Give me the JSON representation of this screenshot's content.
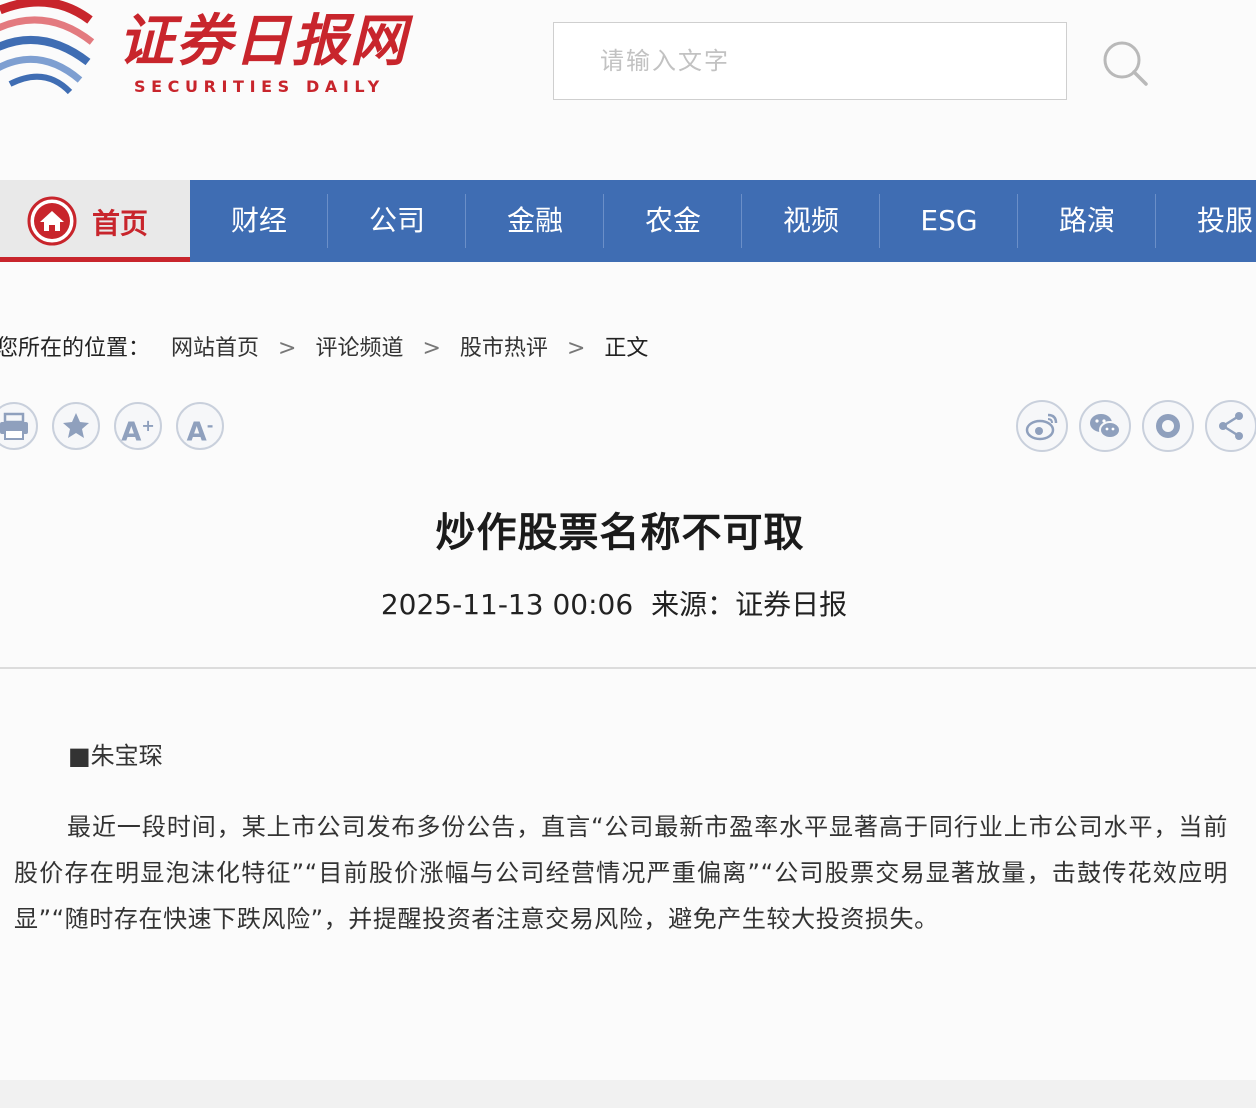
{
  "site": {
    "logo_cn": "证券日报网",
    "logo_en": "SECURITIES DAILY",
    "brand_color": "#c8252c",
    "nav_color": "#3f6db3"
  },
  "search": {
    "placeholder": "请输入文字",
    "icon": "search-icon"
  },
  "nav": {
    "home": {
      "label": "首页",
      "icon": "home-icon"
    },
    "items": [
      "财经",
      "公司",
      "金融",
      "农金",
      "视频",
      "ESG",
      "路演",
      "投服"
    ]
  },
  "breadcrumb": {
    "prefix": "您所在的位置：",
    "items": [
      "网站首页",
      "评论频道",
      "股市热评",
      "正文"
    ],
    "separator": ">"
  },
  "toolbar": {
    "left": [
      "print-icon",
      "favorite-star-icon",
      "font-increase-icon",
      "font-decrease-icon"
    ],
    "right": [
      "weibo-icon",
      "wechat-icon",
      "qzone-icon",
      "share-icon"
    ],
    "font_increase_label": "A",
    "font_increase_sup": "+",
    "font_decrease_label": "A",
    "font_decrease_sup": "-"
  },
  "article": {
    "title": "炒作股票名称不可取",
    "datetime": "2025-11-13 00:06",
    "source": "来源：证券日报",
    "author": "■朱宝琛",
    "body": "最近一段时间，某上市公司发布多份公告，直言“公司最新市盈率水平显著高于同行业上市公司水平，当前股价存在明显泡沫化特征”“目前股价涨幅与公司经营情况严重偏离”“公司股票交易显著放量，击鼓传花效应明显”“随时存在快速下跌风险”，并提醒投资者注意交易风险，避免产生较大投资损失。"
  }
}
